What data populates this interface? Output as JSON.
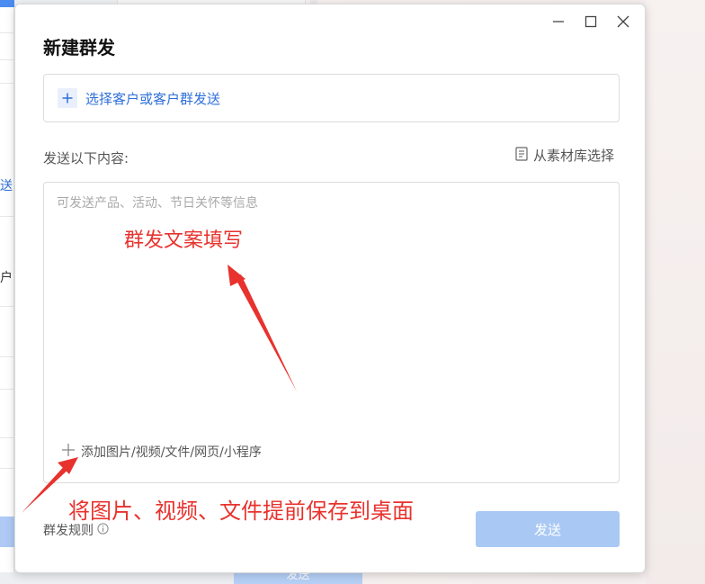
{
  "background": {
    "left_text_1": "送",
    "left_text_2": "户",
    "bottom_button": "发送"
  },
  "dialog": {
    "title": "新建群发",
    "window_controls": {
      "minimize": "minimize-icon",
      "maximize": "maximize-icon",
      "close": "close-icon"
    },
    "select_recipients": {
      "label": "选择客户或客户群发送",
      "icon": "plus-icon"
    },
    "content_section": {
      "label": "发送以下内容:",
      "material_link": "从素材库选择",
      "material_icon": "document-icon",
      "placeholder": "可发送产品、活动、节日关怀等信息",
      "add_media": "添加图片/视频/文件/网页/小程序",
      "add_media_icon": "plus-icon"
    },
    "footer": {
      "rule_link": "群发规则",
      "rule_icon": "info-icon",
      "send_button": "发送"
    }
  },
  "annotations": {
    "text_1": "群发文案填写",
    "text_2": "将图片、视频、文件提前保存到桌面",
    "color": "#e8322d"
  },
  "colors": {
    "accent": "#2f6fd8",
    "send_disabled": "#a9c8f4"
  }
}
